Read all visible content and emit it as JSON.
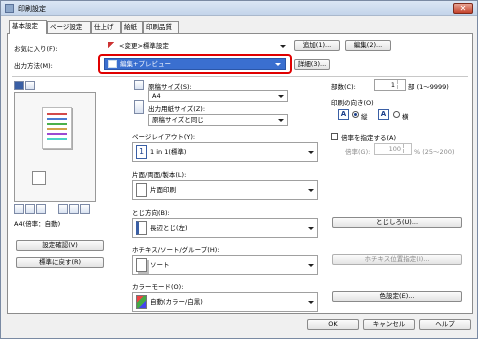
{
  "window": {
    "title": "印刷設定",
    "close_label": "✕"
  },
  "tabs": [
    {
      "label": "基本設定"
    },
    {
      "label": "ページ設定"
    },
    {
      "label": "仕上げ"
    },
    {
      "label": "給紙"
    },
    {
      "label": "印刷品質"
    }
  ],
  "favorites": {
    "label": "お気に入り(F):",
    "value": "<変更>標準設定",
    "add_button": "追加(1)...",
    "edit_button": "編集(2)..."
  },
  "output_method": {
    "label": "出力方法(M):",
    "value": "編集+プレビュー",
    "details_button": "詳細(3)..."
  },
  "preview": {
    "paper_label": "A4(倍率：自動)",
    "settings_check_button": "設定確認(V)",
    "restore_defaults_button": "標準に戻す(R)"
  },
  "original_size": {
    "label": "原稿サイズ(S):",
    "value": "A4"
  },
  "output_paper_size": {
    "label": "出力用紙サイズ(Z):",
    "value": "原稿サイズと同じ"
  },
  "copies": {
    "label": "部数(C):",
    "value": "1",
    "unit": "部 (1～9999)"
  },
  "orientation": {
    "label": "印刷の向き(O)",
    "portrait_label": "縦",
    "landscape_label": "横",
    "selected": "portrait"
  },
  "scaling": {
    "checkbox_label": "倍率を指定する(A)",
    "percent_label": "倍率(G):",
    "value": "100",
    "unit": "% (25～200)"
  },
  "page_layout": {
    "label": "ページレイアウト(Y):",
    "value": "1 in 1(標準)"
  },
  "duplex": {
    "label": "片面/両面/製本(L):",
    "value": "片面印刷"
  },
  "binding": {
    "label": "とじ方向(B):",
    "value": "長辺とじ(左)",
    "margin_button": "とじしろ(U)..."
  },
  "staple": {
    "label": "ホチキス/ソート/グループ(H):",
    "value": "ソート",
    "position_button": "ホチキス位置指定(I)..."
  },
  "color_mode": {
    "label": "カラーモード(O):",
    "value": "自動(カラー/白黒)",
    "color_settings_button": "色設定(E)..."
  },
  "footer": {
    "ok": "OK",
    "cancel": "キャンセル",
    "help": "ヘルプ"
  },
  "colors": {
    "highlight": "#3a6fd0",
    "outline": "#e00000"
  }
}
